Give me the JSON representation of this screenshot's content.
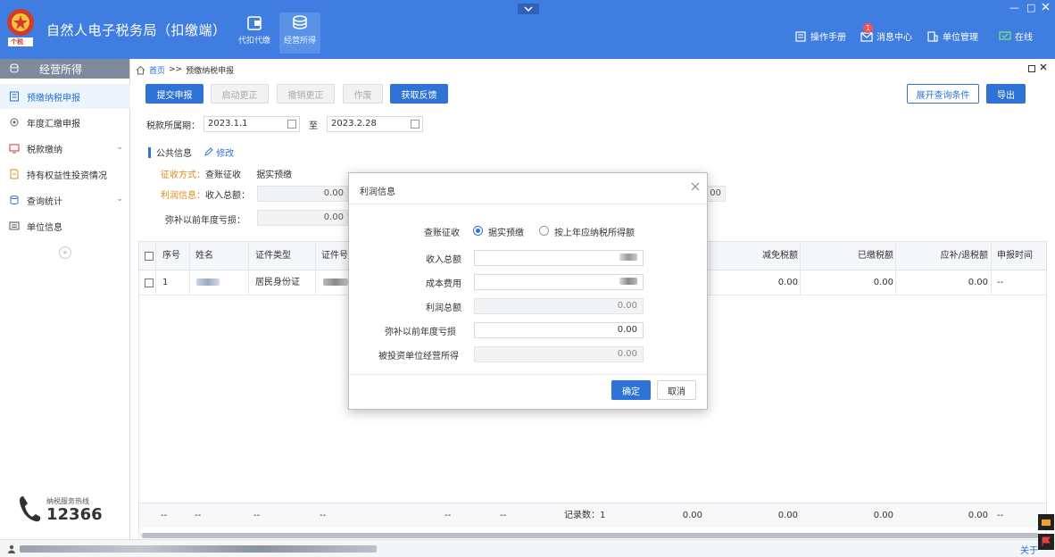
{
  "header": {
    "emblem_text": "个税",
    "title": "自然人电子税务局（扣缴端）",
    "nav": [
      {
        "label": "代扣代缴",
        "icon": "wallet-icon"
      },
      {
        "label": "经营所得",
        "icon": "coins-icon"
      }
    ],
    "tools": {
      "manual": "操作手册",
      "messages": "消息中心",
      "messages_badge": "1",
      "unit_mgmt": "单位管理",
      "online": "在线"
    },
    "window_controls": [
      "—",
      "□"
    ]
  },
  "sidebar": {
    "header": "经营所得",
    "items": [
      {
        "label": "预缴纳税申报",
        "icon": "form-icon"
      },
      {
        "label": "年度汇缴申报",
        "icon": "gear-icon"
      },
      {
        "label": "税款缴纳",
        "icon": "monitor-icon"
      },
      {
        "label": "持有权益性投资情况",
        "icon": "document-icon"
      },
      {
        "label": "查询统计",
        "icon": "database-icon"
      },
      {
        "label": "单位信息",
        "icon": "list-icon"
      }
    ],
    "collapse": "«",
    "hotline_label": "纳税服务热线",
    "hotline_number": "12366"
  },
  "breadcrumb": {
    "home": "首页",
    "sep": ">>",
    "current": "预缴纳税申报"
  },
  "toolbar": {
    "submit": "提交申报",
    "start_correct": "启动更正",
    "cancel_correct": "撤销更正",
    "void": "作废",
    "get_feedback": "获取反馈",
    "expand_query": "展开查询条件",
    "export": "导出"
  },
  "period": {
    "label": "税款所属期：",
    "from": "2023.1.1",
    "to_label": "至",
    "to": "2023.2.28"
  },
  "public_info": {
    "title": "公共信息",
    "edit": "修改",
    "method_label": "征收方式：",
    "method_value": "查账征收",
    "method_detail": "据实预缴",
    "profit_label": "利润信息：",
    "income_label": "收入总额：",
    "income_value": "0.00",
    "loss_label": "弥补以前年度亏损：",
    "loss_value": "0.00",
    "hidden_value": "00"
  },
  "table": {
    "columns": [
      "序号",
      "姓名",
      "证件类型",
      "证件号",
      "减免税额",
      "已缴税额",
      "应补/退税额",
      "申报时间"
    ],
    "rows": [
      {
        "seq": "1",
        "id_type": "居民身份证",
        "relief": "0.00",
        "paid": "0.00",
        "due": "0.00",
        "time": "--"
      }
    ],
    "footer": {
      "placeholders": [
        "--",
        "--",
        "--",
        "--",
        "--",
        "--"
      ],
      "record_label": "记录数：1",
      "c1": "0.00",
      "c2": "0.00",
      "c3": "0.00",
      "c4": "0.00",
      "time": "--"
    }
  },
  "modal": {
    "title": "利润信息",
    "close": "×",
    "method_label": "查账征收",
    "option1": "据实预缴",
    "option2": "按上年应纳税所得额",
    "income_label": "收入总额",
    "cost_label": "成本费用",
    "profit_label": "利润总额",
    "profit_value": "0.00",
    "loss_label": "弥补以前年度亏损",
    "loss_value": "0.00",
    "invested_label": "被投资单位经营所得",
    "invested_value": "0.00",
    "ok": "确定",
    "cancel": "取消"
  },
  "statusbar": {
    "right_link": "关于"
  },
  "colors": {
    "header_bg": "#3f7de0",
    "primary": "#2f72d6",
    "accent_orange": "#e08a1e"
  }
}
